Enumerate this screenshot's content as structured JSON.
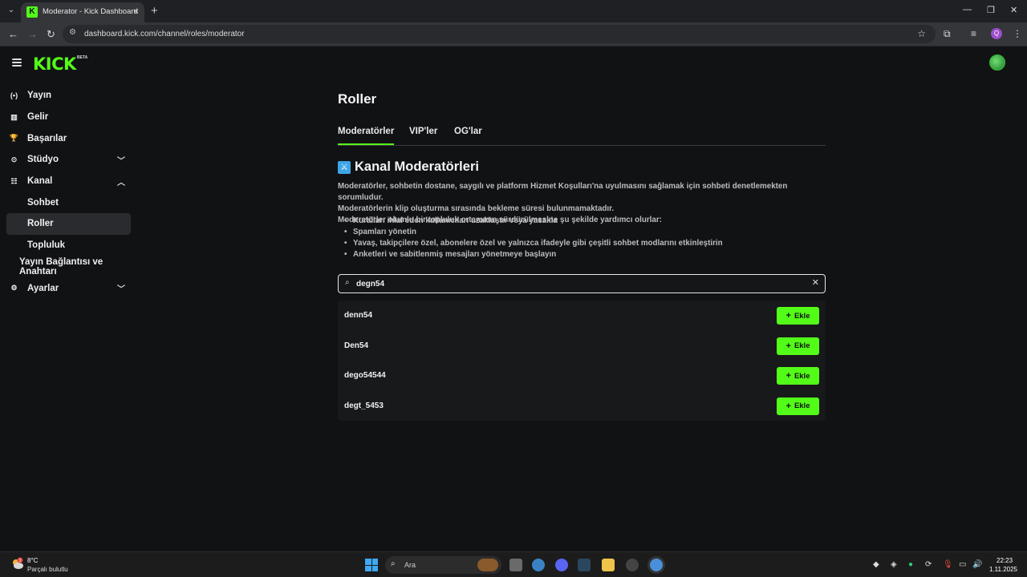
{
  "browser": {
    "tab_title": "Moderator - Kick Dashboard",
    "url": "dashboard.kick.com/channel/roles/moderator",
    "profile_initial": "Q"
  },
  "header": {
    "logo": "KICK",
    "logo_badge": "BETA"
  },
  "sidebar": {
    "items": [
      {
        "label": "Yayın",
        "icon": "broadcast-icon"
      },
      {
        "label": "Gelir",
        "icon": "revenue-icon"
      },
      {
        "label": "Başarılar",
        "icon": "trophy-icon"
      },
      {
        "label": "Stüdyo",
        "icon": "studio-icon"
      },
      {
        "label": "Kanal",
        "icon": "channel-icon"
      },
      {
        "label": "Sohbet"
      },
      {
        "label": "Roller"
      },
      {
        "label": "Topluluk"
      },
      {
        "label": "Yayın Bağlantısı ve Anahtarı"
      },
      {
        "label": "Ayarlar",
        "icon": "gear-icon"
      }
    ]
  },
  "main": {
    "title": "Roller",
    "tabs": [
      {
        "label": "Moderatörler"
      },
      {
        "label": "VIP'ler"
      },
      {
        "label": "OG'lar"
      }
    ],
    "section_title": "Kanal Moderatörleri",
    "description": [
      "Moderatörler, sohbetin dostane, saygılı ve platform Hizmet Koşulları'na uyulmasını sağlamak için sohbeti denetlemekten sorumludur.",
      "Moderatörlerin klip oluşturma sırasında bekleme süresi bulunmamaktadır.",
      "Moderatörler olumlu bir topluluk ortamının sürdürülmesine şu şekilde yardımcı olurlar:"
    ],
    "bullets": [
      "Kuralları ihlal eden kullanıcıları uzaklaştır veya yasakla",
      "Spamları yönetin",
      "Yavaş, takipçilere özel, abonelere özel ve yalnızca ifadeyle gibi çeşitli sohbet modlarını etkinleştirin",
      "Anketleri ve sabitlenmiş mesajları yönetmeye başlayın"
    ],
    "search": {
      "value": "degn54",
      "placeholder": ""
    },
    "results": [
      {
        "name": "denn54",
        "action": "Ekle"
      },
      {
        "name": "Den54",
        "action": "Ekle"
      },
      {
        "name": "dego54544",
        "action": "Ekle"
      },
      {
        "name": "degt_5453",
        "action": "Ekle"
      }
    ]
  },
  "taskbar": {
    "weather_temp": "8°C",
    "weather_desc": "Parçalı bulutlu",
    "weather_badge": "3",
    "search_label": "Ara",
    "time": "22:23",
    "date": "1.11.2025"
  },
  "colors": {
    "accent": "#53fc18",
    "background": "#111214",
    "result_bg": "#18191b"
  }
}
